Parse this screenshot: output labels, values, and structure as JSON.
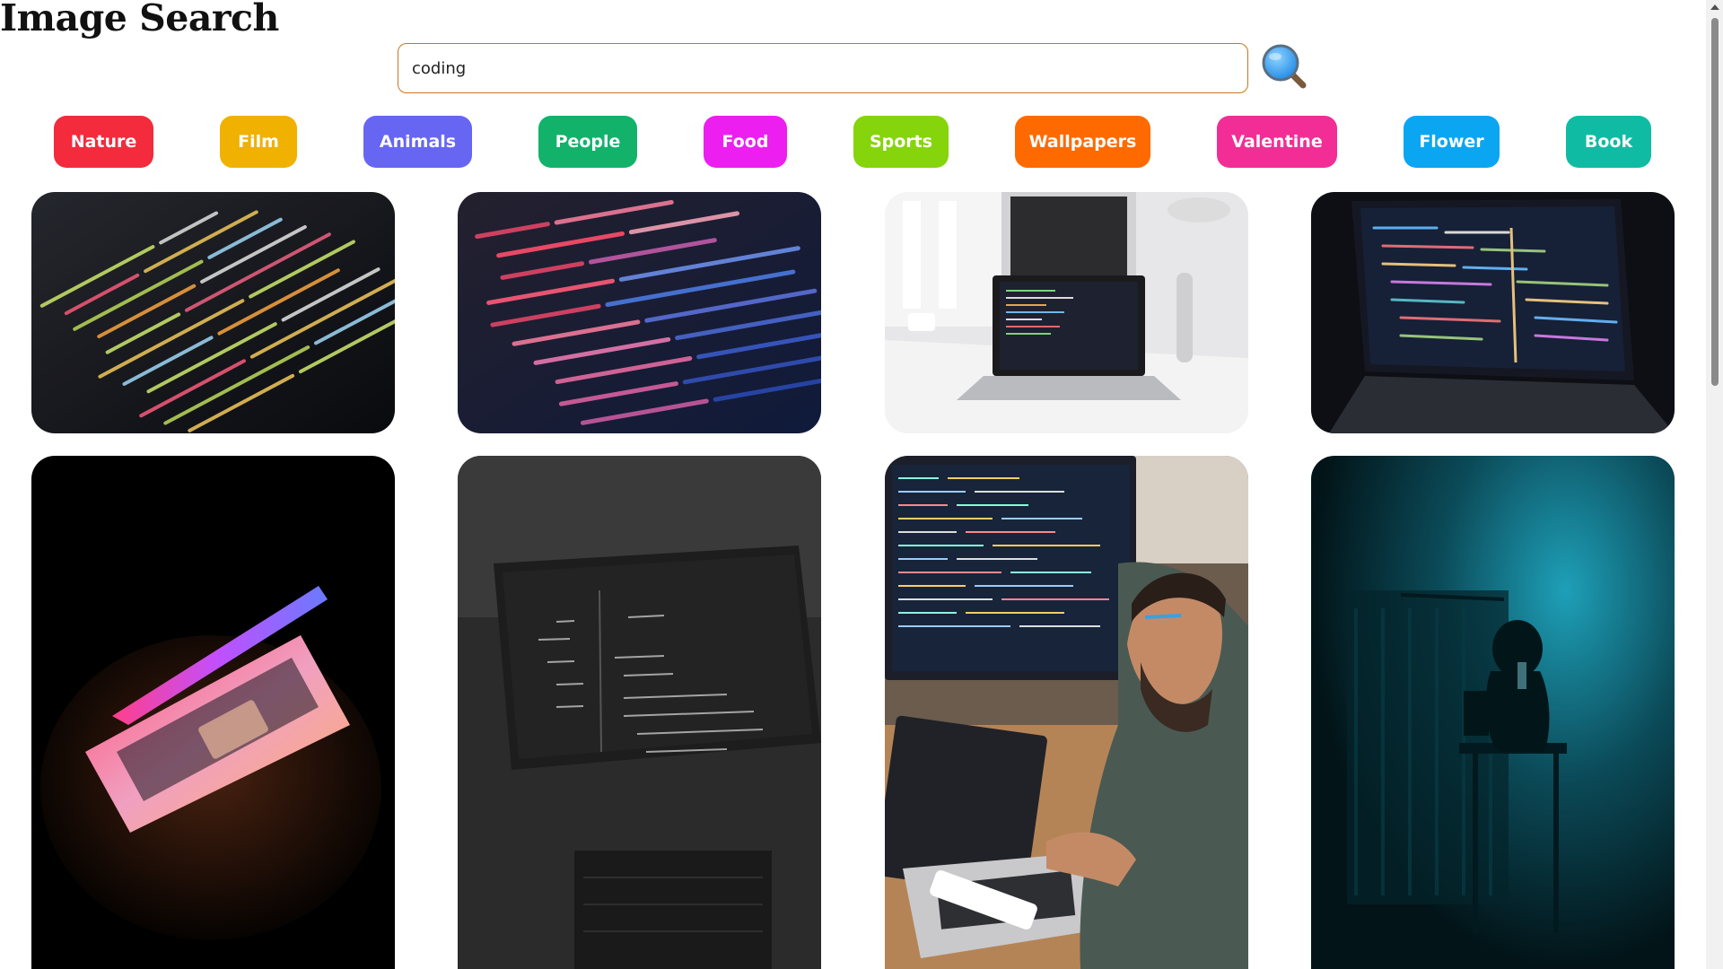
{
  "page": {
    "title": "Image Search"
  },
  "search": {
    "value": "coding",
    "button_icon": "magnifier-icon"
  },
  "categories": [
    {
      "label": "Nature",
      "color": "#f42a3d"
    },
    {
      "label": "Film",
      "color": "#f0b100"
    },
    {
      "label": "Animals",
      "color": "#6766f3"
    },
    {
      "label": "People",
      "color": "#12b26b"
    },
    {
      "label": "Food",
      "color": "#ec1ff0"
    },
    {
      "label": "Sports",
      "color": "#86d40b"
    },
    {
      "label": "Wallpapers",
      "color": "#ff6a00"
    },
    {
      "label": "Valentine",
      "color": "#f22e96"
    },
    {
      "label": "Flower",
      "color": "#0aa6f2"
    },
    {
      "label": "Book",
      "color": "#10bba4"
    }
  ],
  "results": [
    {
      "subject": "code-editor-closeup-icon"
    },
    {
      "subject": "svg-code-screen-icon"
    },
    {
      "subject": "laptop-desk-icon"
    },
    {
      "subject": "laptop-dark-editor-icon"
    },
    {
      "subject": "glowing-laptop-icon"
    },
    {
      "subject": "monochrome-laptop-icon"
    },
    {
      "subject": "developer-workstation-icon"
    },
    {
      "subject": "teal-room-silhouette-icon"
    }
  ]
}
